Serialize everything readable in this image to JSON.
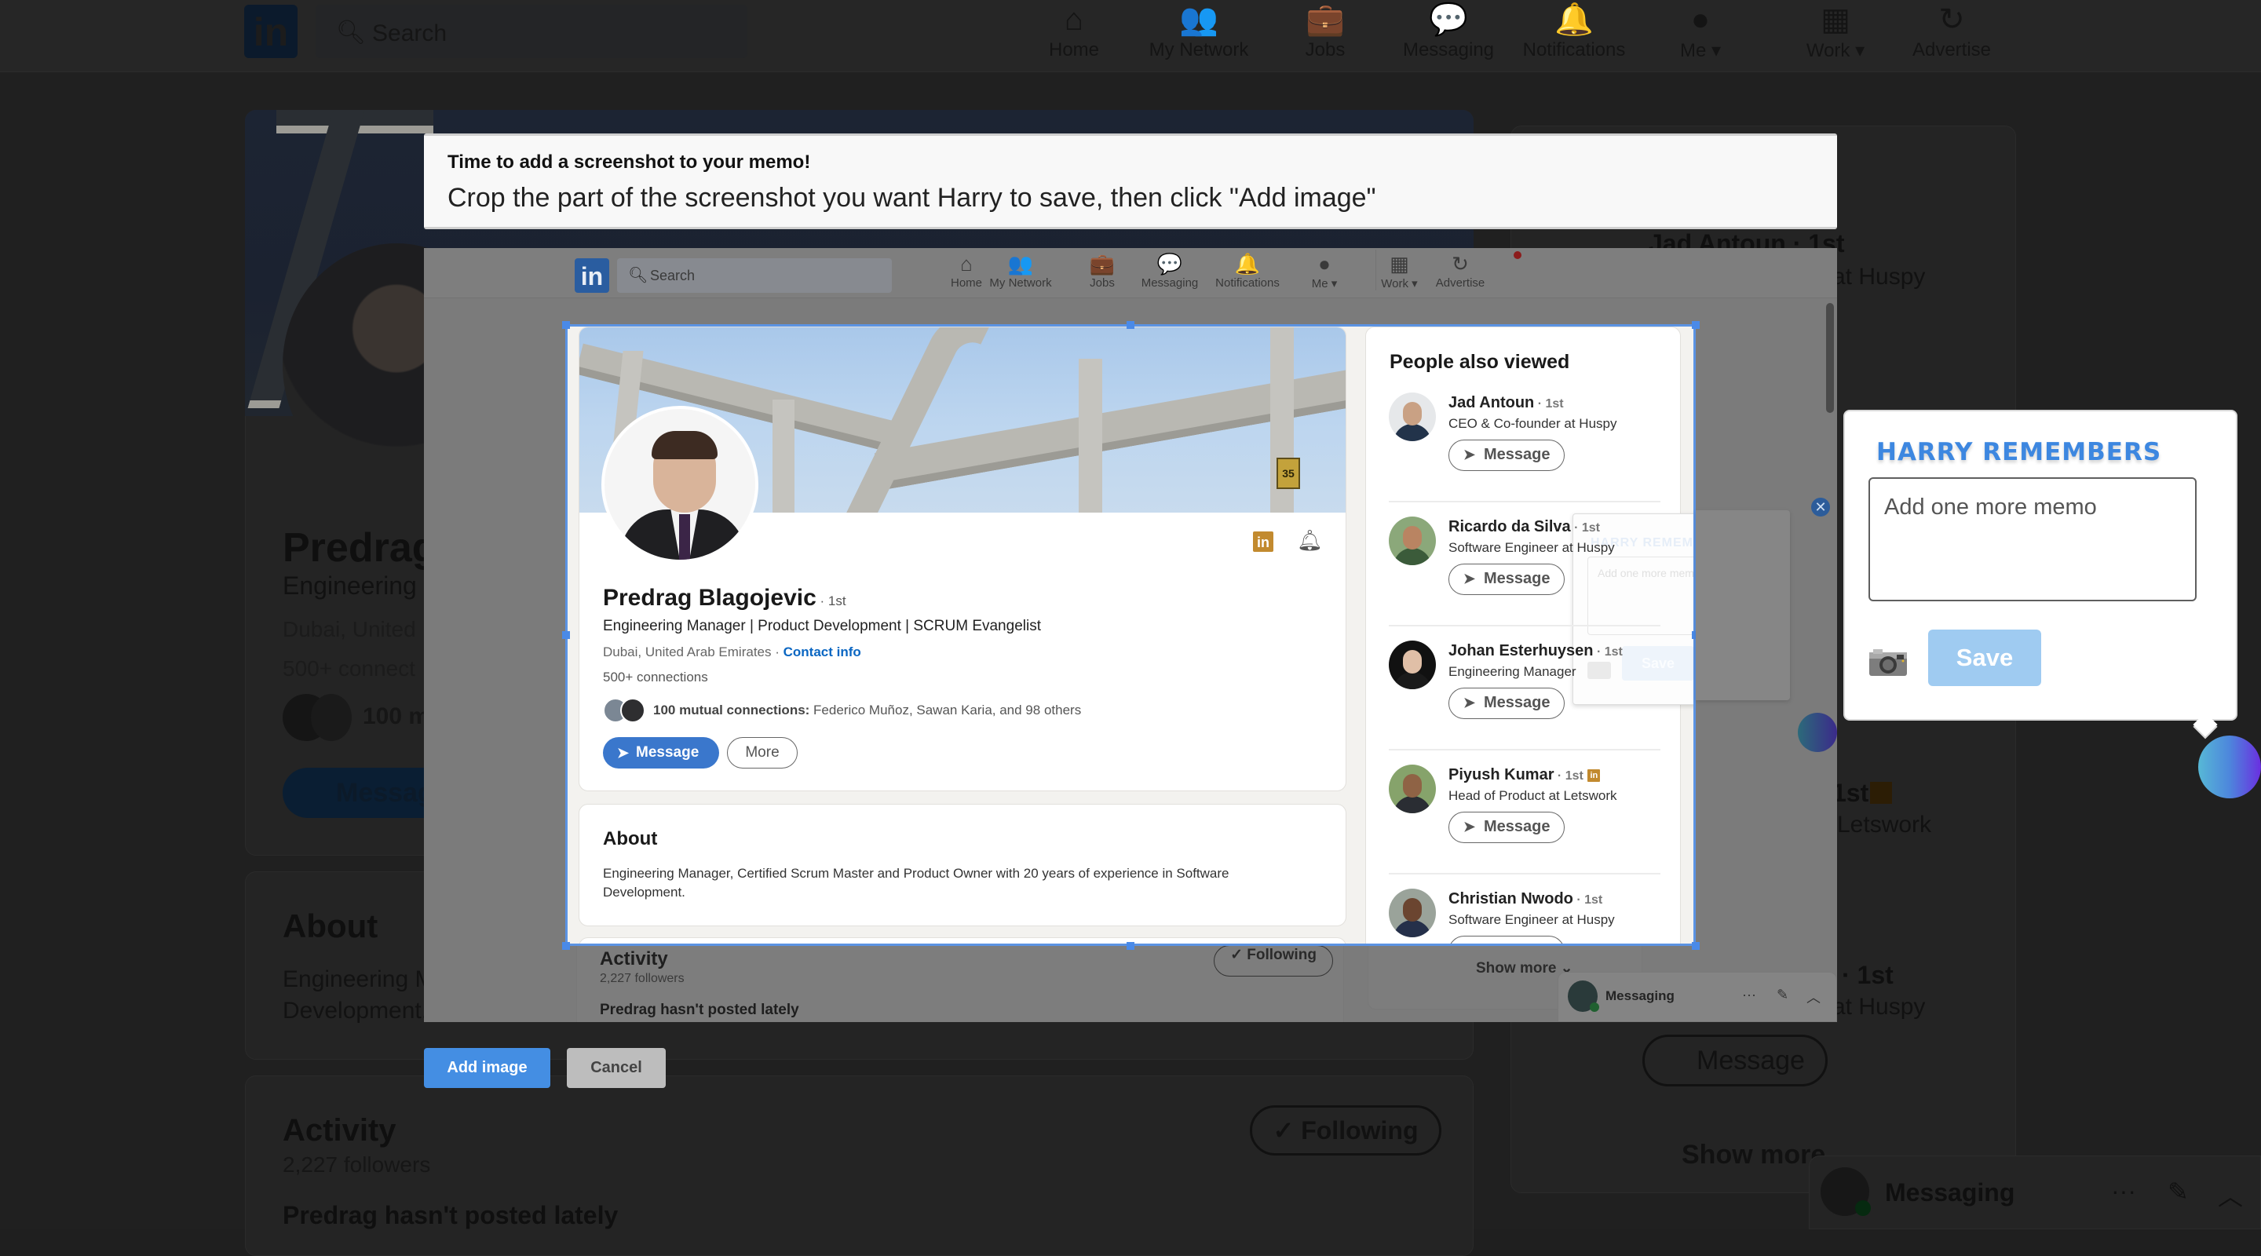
{
  "background_page": {
    "nav": {
      "search_placeholder": "Search",
      "items": [
        {
          "label": "Home",
          "icon": "home-icon",
          "glyph": "⌂"
        },
        {
          "label": "My Network",
          "icon": "network-icon",
          "glyph": "👥"
        },
        {
          "label": "Jobs",
          "icon": "briefcase-icon",
          "glyph": "💼"
        },
        {
          "label": "Messaging",
          "icon": "chat-icon",
          "glyph": "💬"
        },
        {
          "label": "Notifications",
          "icon": "bell-icon",
          "glyph": "🔔"
        },
        {
          "label": "Me ▾",
          "icon": "avatar-icon",
          "glyph": "●"
        },
        {
          "label": "Work ▾",
          "icon": "grid-icon",
          "glyph": "▦"
        },
        {
          "label": "Advertise",
          "icon": "advertise-icon",
          "glyph": "↻"
        }
      ]
    },
    "profile": {
      "name_partial": "Predrag",
      "headline_partial": "Engineering",
      "location_partial": "Dubai, United",
      "connections_partial": "500+ connect",
      "mutual_partial": "100 m",
      "message_partial": "Messag"
    },
    "about": {
      "heading": "About",
      "text_partial": "Engineering M Development."
    },
    "activity": {
      "heading": "Activity",
      "followers": "2,227 followers",
      "post_status": "Predrag hasn't posted lately",
      "following_label": "✓ Following"
    },
    "right_column": {
      "jad_partial": "Jad Antoun · 1st",
      "huspy_partial_1": "at Huspy",
      "piyush_badge_partial": "1st",
      "letswork_partial": "Letswork",
      "christian_partial": "· 1st",
      "huspy_partial_2": "at Huspy",
      "message_label": "Message",
      "show_more": "Show more"
    },
    "messaging_bar": {
      "label": "Messaging",
      "more": "···",
      "compose": "✎",
      "collapse": "︿"
    }
  },
  "banner": {
    "title": "Time to add a screenshot to your memo!",
    "instruction": "Crop the part of the screenshot you want Harry to save, then click \"Add image\""
  },
  "screenshot": {
    "nav": {
      "search_placeholder": "Search",
      "items": [
        {
          "label": "Home",
          "glyph": "⌂"
        },
        {
          "label": "My Network",
          "glyph": "👥"
        },
        {
          "label": "Jobs",
          "glyph": "💼"
        },
        {
          "label": "Messaging",
          "glyph": "💬"
        },
        {
          "label": "Notifications",
          "glyph": "🔔"
        },
        {
          "label": "Me ▾",
          "glyph": "●"
        },
        {
          "label": "Work ▾",
          "glyph": "▦"
        },
        {
          "label": "Advertise",
          "glyph": "↻"
        }
      ]
    },
    "profile": {
      "name": "Predrag Blagojevic",
      "degree": " · 1st",
      "headline": "Engineering Manager | Product Development | SCRUM Evangelist",
      "location": "Dubai, United Arab Emirates · ",
      "contact_info": "Contact info",
      "connections": "500+ connections",
      "mutual_bold": "100 mutual connections:",
      "mutual_names": " Federico Muñoz, Sawan Karia, and 98 others",
      "message_button": "Message",
      "more_button": "More"
    },
    "about": {
      "heading": "About",
      "text": "Engineering Manager, Certified Scrum Master and Product Owner with 20 years of experience in Software Development."
    },
    "activity": {
      "heading": "Activity",
      "followers": "2,227 followers",
      "post_status": "Predrag hasn't posted lately",
      "following_button": "✓ Following"
    },
    "people_also_viewed": {
      "heading": "People also viewed",
      "people": [
        {
          "name": "Jad Antoun",
          "degree": " · 1st",
          "title": "CEO & Co-founder at Huspy",
          "button": "Message",
          "li_badge": false
        },
        {
          "name": "Ricardo da Silva",
          "degree": " · 1st",
          "title": "Software Engineer at Huspy",
          "button": "Message",
          "li_badge": false
        },
        {
          "name": "Johan Esterhuysen",
          "degree": " · 1st",
          "title": "Engineering Manager",
          "button": "Message",
          "li_badge": false
        },
        {
          "name": "Piyush Kumar",
          "degree": " · 1st",
          "title": "Head of Product at Letswork",
          "button": "Message",
          "li_badge": true
        },
        {
          "name": "Christian Nwodo",
          "degree": " · 1st",
          "title": "Software Engineer at Huspy",
          "button": "Message",
          "li_badge": false
        }
      ],
      "show_more": "Show more ⌄"
    },
    "ghost_popup": {
      "title": "HARRY REMEMBERS",
      "placeholder": "Add one more memo",
      "save": "Save"
    },
    "messaging_bar": {
      "label": "Messaging",
      "more": "···",
      "compose": "✎",
      "collapse": "︿"
    }
  },
  "actions": {
    "add_image": "Add image",
    "cancel": "Cancel"
  },
  "harry_popup": {
    "title": "HARRY REMEMBERS",
    "memo_placeholder": "Add one more memo",
    "memo_value": "",
    "camera_icon": "📷",
    "save": "Save",
    "accent_color": "#3d87e0",
    "save_color": "#9fcbf1"
  }
}
